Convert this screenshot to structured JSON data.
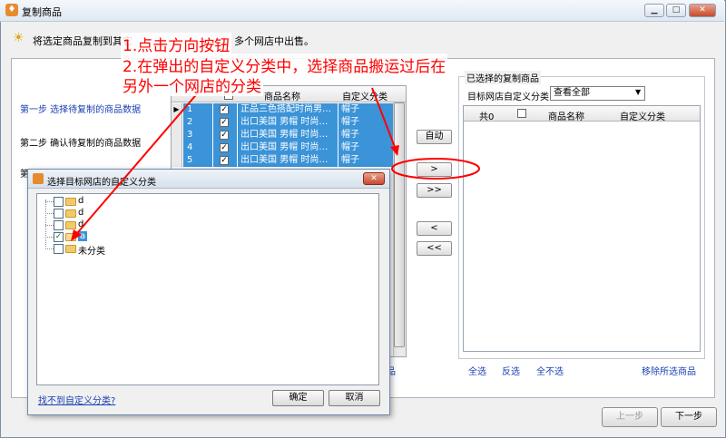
{
  "window": {
    "title": "复制商品",
    "icon": "app-icon",
    "minimize": "▁",
    "maximize": "□",
    "close": "✕"
  },
  "hint": {
    "icon": "lightbulb-icon",
    "text": "将选定商品复制到其它"
  },
  "steps": {
    "step1": "第一步  选择待复制的商品数据",
    "step2": "第二步  确认待复制的商品数据",
    "step3": "第三步"
  },
  "product_grid": {
    "columns": [
      "",
      "商品名称",
      "自定义分类"
    ],
    "rows": [
      {
        "num": "1",
        "name": "正品三色搭配时尚男…",
        "category": "帽子"
      },
      {
        "num": "2",
        "name": "出口美国 男帽 时尚…",
        "category": "帽子"
      },
      {
        "num": "3",
        "name": "出口美国 男帽 时尚…",
        "category": "帽子"
      },
      {
        "num": "4",
        "name": "出口美国 男帽 时尚…",
        "category": "帽子"
      },
      {
        "num": "5",
        "name": "出口美国 男帽 时尚…",
        "category": "帽子"
      }
    ],
    "footer_link": "商品"
  },
  "middle_buttons": {
    "auto": "自动",
    "move_one": ">",
    "move_all": ">>",
    "back_one": "<",
    "back_all": "<<"
  },
  "right_panel": {
    "group_title": "已选择的复制商品",
    "filter_label": "目标网店自定义分类",
    "filter_value": "查看全部",
    "columns": {
      "total": "共0",
      "name": "商品名称",
      "category": "自定义分类"
    },
    "links": {
      "select_all": "全选",
      "invert": "反选",
      "select_none": "全不选",
      "remove": "移除所选商品"
    }
  },
  "footer": {
    "prev": "上一步",
    "next": "下一步"
  },
  "annotations": {
    "line1": "1.点击方向按钮",
    "line2": "2.在弹出的自定义分类中，选择商品搬运过后在",
    "line3": "另外一个网店的分类",
    "trailing": "多个网店中出售。",
    "color": "#ff0000"
  },
  "dialog": {
    "title": "选择目标网店的自定义分类",
    "close": "✕",
    "tree": [
      {
        "label": "d",
        "checked": false
      },
      {
        "label": "d",
        "checked": false
      },
      {
        "label": "d",
        "checked": false
      },
      {
        "label": "a",
        "checked": true
      },
      {
        "label": "未分类",
        "checked": false
      }
    ],
    "link": "找不到自定义分类?",
    "ok": "确定",
    "cancel": "取消"
  }
}
